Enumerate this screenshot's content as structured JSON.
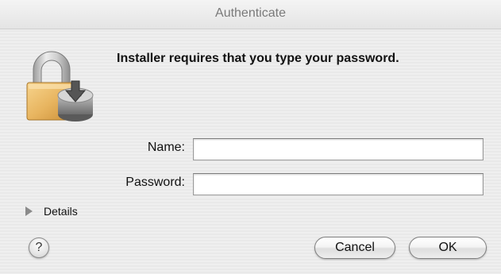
{
  "window": {
    "title": "Authenticate"
  },
  "dialog": {
    "message": "Installer requires that you type your password.",
    "icon": "lock-icon"
  },
  "form": {
    "name_label": "Name:",
    "name_value": "",
    "password_label": "Password:",
    "password_value": ""
  },
  "details": {
    "label": "Details",
    "expanded": false
  },
  "buttons": {
    "help_label": "?",
    "cancel_label": "Cancel",
    "ok_label": "OK"
  },
  "colors": {
    "background": "#ececec",
    "lock_gold": "#e5b15a",
    "shackle_gray": "#b9b9b9"
  }
}
